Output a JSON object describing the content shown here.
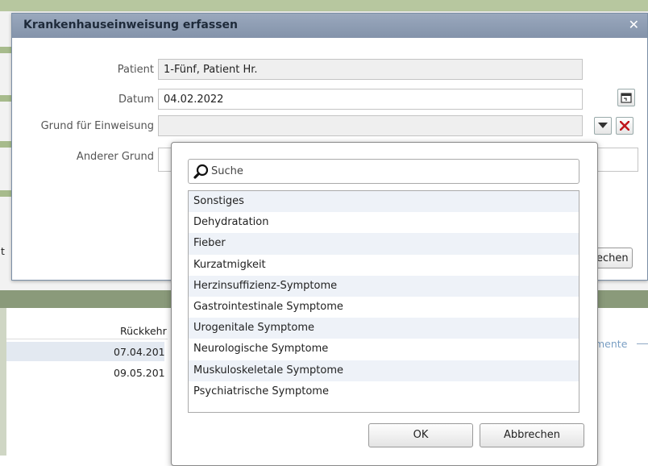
{
  "background": {
    "table_column_header": "Rückkehr",
    "rows": [
      "07.04.201",
      "09.05.201"
    ],
    "right_label": "mente",
    "left_fragment": "t"
  },
  "dialog": {
    "title": "Krankenhauseinweisung erfassen",
    "close_icon": "close-icon",
    "fields": {
      "patient": {
        "label": "Patient",
        "value": "1-Fünf, Patient Hr."
      },
      "datum": {
        "label": "Datum",
        "value": "04.02.2022"
      },
      "grund": {
        "label": "Grund für Einweisung",
        "value": ""
      },
      "anderer": {
        "label": "Anderer Grund",
        "value": ""
      }
    },
    "partial_button": "echen"
  },
  "popup": {
    "search_placeholder": "Suche",
    "items": [
      "Sonstiges",
      "Dehydratation",
      "Fieber",
      "Kurzatmigkeit",
      "Herzinsuffizienz-Symptome",
      "Gastrointestinale Symptome",
      "Urogenitale Symptome",
      "Neurologische Symptome",
      "Muskuloskeletale Symptome",
      "Psychiatrische Symptome"
    ],
    "ok": "OK",
    "cancel": "Abbrechen"
  },
  "colors": {
    "title_bar": "#8b9ab0",
    "background_green": "#a7bb8c",
    "clear_icon": "#c0171d",
    "list_stripe": "#eef2f8"
  }
}
